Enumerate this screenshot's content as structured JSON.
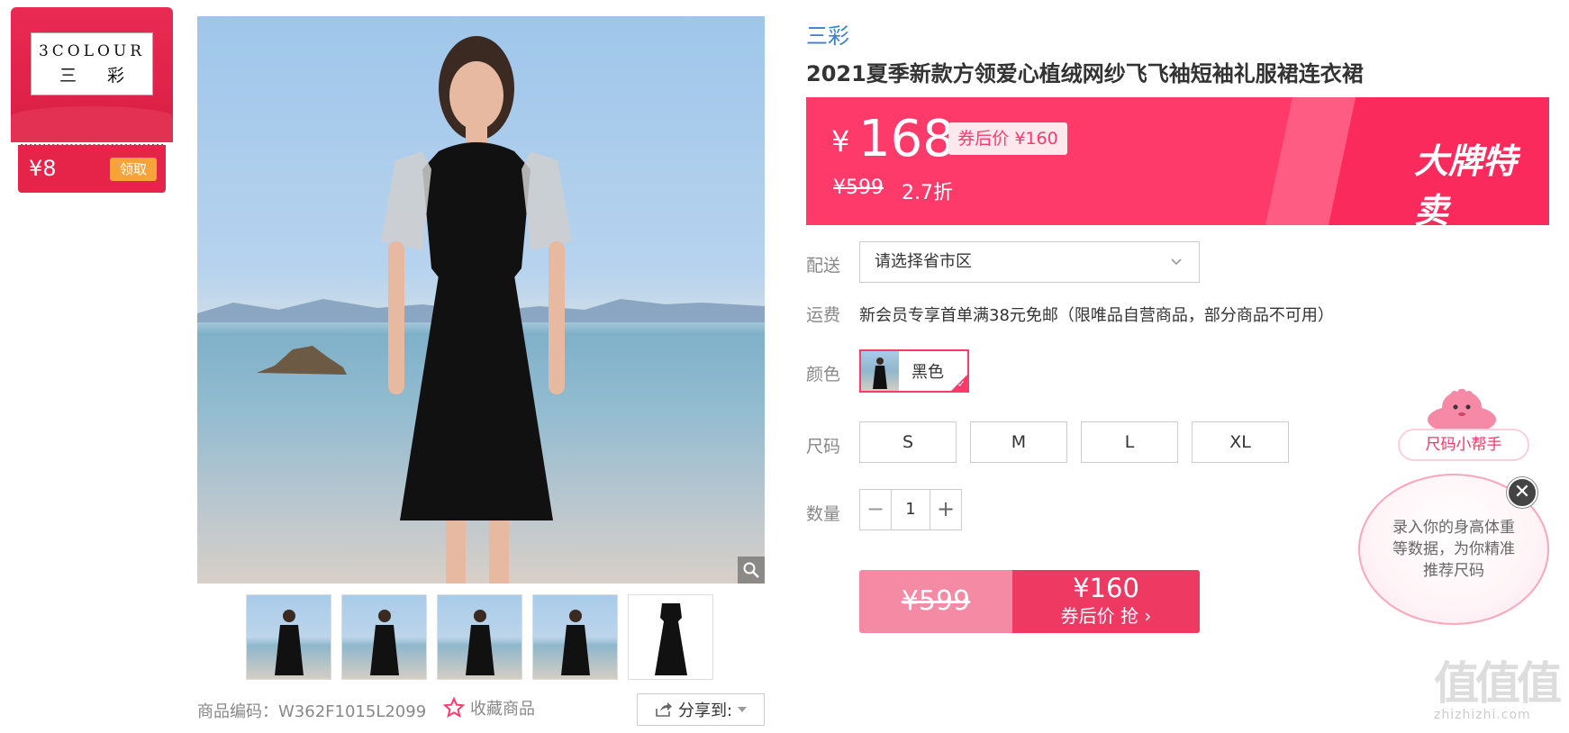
{
  "brand": {
    "logo_line1": "3COLOUR",
    "logo_line2": "三 彩",
    "coupon_amount": "¥8",
    "coupon_button": "领取"
  },
  "gallery": {
    "thumbnail_count": 5
  },
  "meta": {
    "product_code": "商品编码：W362F1015L2099",
    "favorite_label": "收藏商品",
    "share_label": "分享到:"
  },
  "product": {
    "shop_name": "三彩",
    "title": "2021夏季新款方领爱心植绒网纱飞飞袖短袖礼服裙连衣裙"
  },
  "price": {
    "currency": "¥",
    "current": "168",
    "after_coupon": "券后价 ¥160",
    "original": "¥599",
    "discount": "2.7折",
    "promo_badge": "大牌特卖"
  },
  "labels": {
    "delivery": "配送",
    "shipping": "运费",
    "color": "颜色",
    "size": "尺码",
    "quantity": "数量"
  },
  "delivery": {
    "placeholder": "请选择省市区"
  },
  "shipping": {
    "text": "新会员专享首单满38元免邮（限唯品自营商品，部分商品不可用）"
  },
  "color_option": {
    "label": "黑色",
    "selected": true
  },
  "sizes": [
    "S",
    "M",
    "L",
    "XL"
  ],
  "quantity": {
    "minus": "−",
    "value": "1",
    "plus": "+"
  },
  "buy": {
    "original": "¥599",
    "after_price": "¥160",
    "action": "券后价 抢 ›"
  },
  "size_helper": {
    "tag": "尺码小帮手",
    "bubble": "录入你的身高体重等数据，为你精准推荐尺码",
    "close": "✕"
  },
  "watermark": {
    "big": "值值值",
    "small": "zhizhizhi.com"
  },
  "colors": {
    "accent": "#fe3a6a",
    "link": "#3a7fd5",
    "coupon_orange": "#f7a33a"
  }
}
